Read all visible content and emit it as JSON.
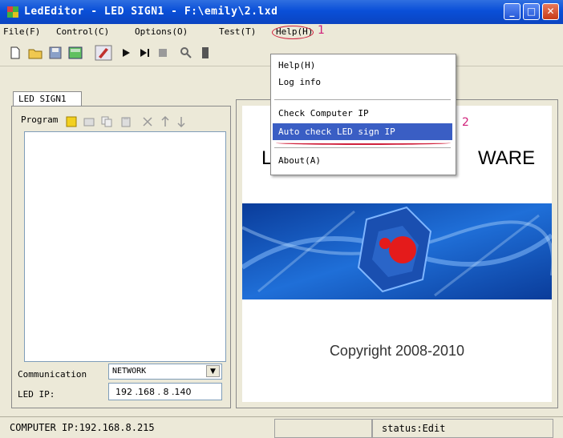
{
  "window": {
    "title": "LedEditor - LED SIGN1 - F:\\emily\\2.lxd",
    "minimize": "_",
    "maximize": "□",
    "close": "✕"
  },
  "menu": [
    "File(F)",
    "Control(C)",
    "Options(O)",
    "Test(T)",
    "Help(H)"
  ],
  "annotations": {
    "help_marker": "1",
    "autocheck_marker": "2"
  },
  "toolbar": {
    "icons": [
      "new-icon",
      "open-icon",
      "save-icon",
      "program-icon",
      "edit-icon",
      "play-icon",
      "play-step-icon",
      "stop-icon",
      "zoom-icon",
      "preview-icon"
    ]
  },
  "left_panel": {
    "tab": "LED SIGN1",
    "program_label": "Program",
    "communication_label": "Communication",
    "communication_value": "NETWORK",
    "led_ip_label": "LED IP:",
    "led_ip_value": "192 .168 . 8  .140"
  },
  "preview": {
    "brand_left": "L",
    "brand_right": "WARE",
    "copyright": "Copyright 2008-2010"
  },
  "help_menu": {
    "items": [
      "Help(H)",
      "Log info",
      "Check Computer IP",
      "Auto check LED sign IP",
      "About(A)"
    ]
  },
  "status": {
    "computer_ip": "COMPUTER IP:192.168.8.215",
    "middle": "",
    "status_text": "status:Edit"
  },
  "colors": {
    "titlebar": "#0a4fd8",
    "menu_highlight": "#3a5ec4",
    "annotation": "#d0207a",
    "annotation_circle": "#d0203c"
  }
}
